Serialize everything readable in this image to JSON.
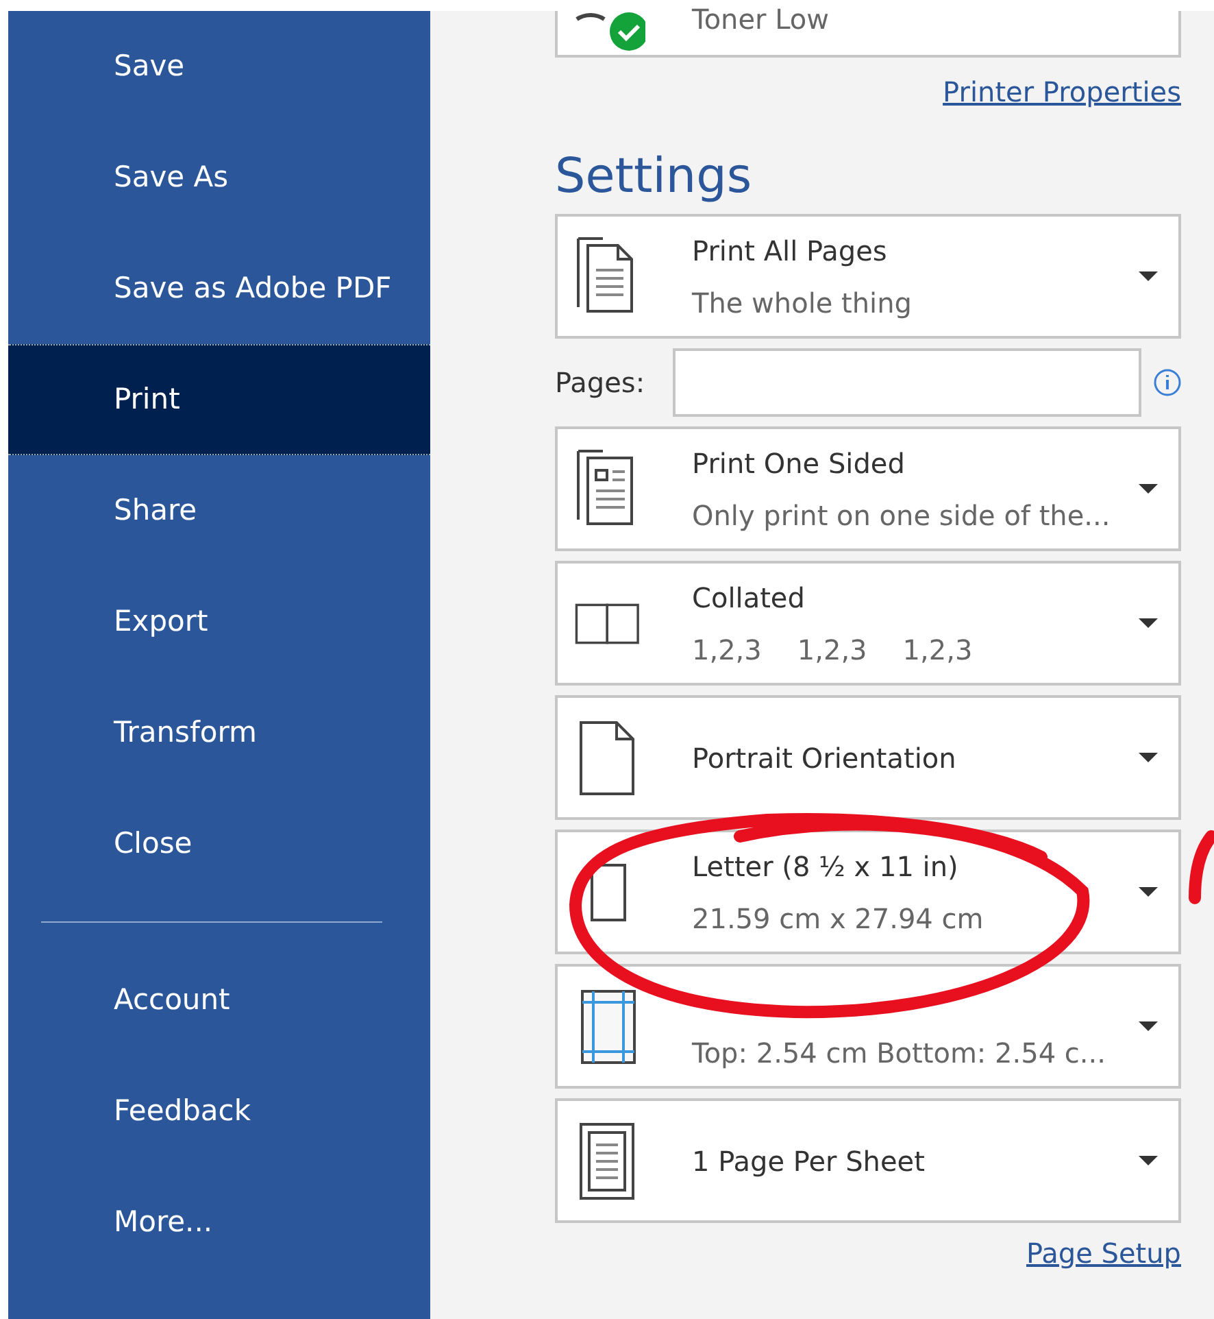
{
  "sidebar": {
    "items": [
      {
        "label": "Save",
        "selected": false
      },
      {
        "label": "Save As",
        "selected": false
      },
      {
        "label": "Save as Adobe PDF",
        "selected": false
      },
      {
        "label": "Print",
        "selected": true
      },
      {
        "label": "Share",
        "selected": false
      },
      {
        "label": "Export",
        "selected": false
      },
      {
        "label": "Transform",
        "selected": false
      },
      {
        "label": "Close",
        "selected": false
      }
    ],
    "footer_items": [
      {
        "label": "Account",
        "selected": false
      },
      {
        "label": "Feedback",
        "selected": false
      },
      {
        "label": "More...",
        "selected": false
      }
    ]
  },
  "printer": {
    "status": "Toner Low",
    "ready": true
  },
  "printer_properties": "Printer Properties",
  "settings": {
    "title": "Settings",
    "options": [
      {
        "kind": "pages",
        "title": "Print All Pages",
        "subtitle": "The whole thing"
      },
      {
        "kind": "field",
        "label": "Pages:"
      },
      {
        "kind": "sides",
        "title": "Print One Sided",
        "subtitle": "Only print on one side of the..."
      },
      {
        "kind": "collated",
        "title": "Collated",
        "subtitle_parts": [
          "1,2,3",
          "1,2,3",
          "1,2,3"
        ]
      },
      {
        "kind": "orientation",
        "title": "Portrait Orientation"
      },
      {
        "kind": "paper",
        "title": "Letter (8 ½ x 11 in)",
        "subtitle": "21.59 cm x 27.94 cm"
      },
      {
        "kind": "margins",
        "subtitle": "Top: 2.54 cm Bottom: 2.54 c..."
      },
      {
        "kind": "persheet",
        "title": "1 Page Per Sheet"
      }
    ]
  },
  "page_setup": "Page Setup",
  "annotation": {
    "kind": "circle",
    "color": "#e8101f"
  }
}
